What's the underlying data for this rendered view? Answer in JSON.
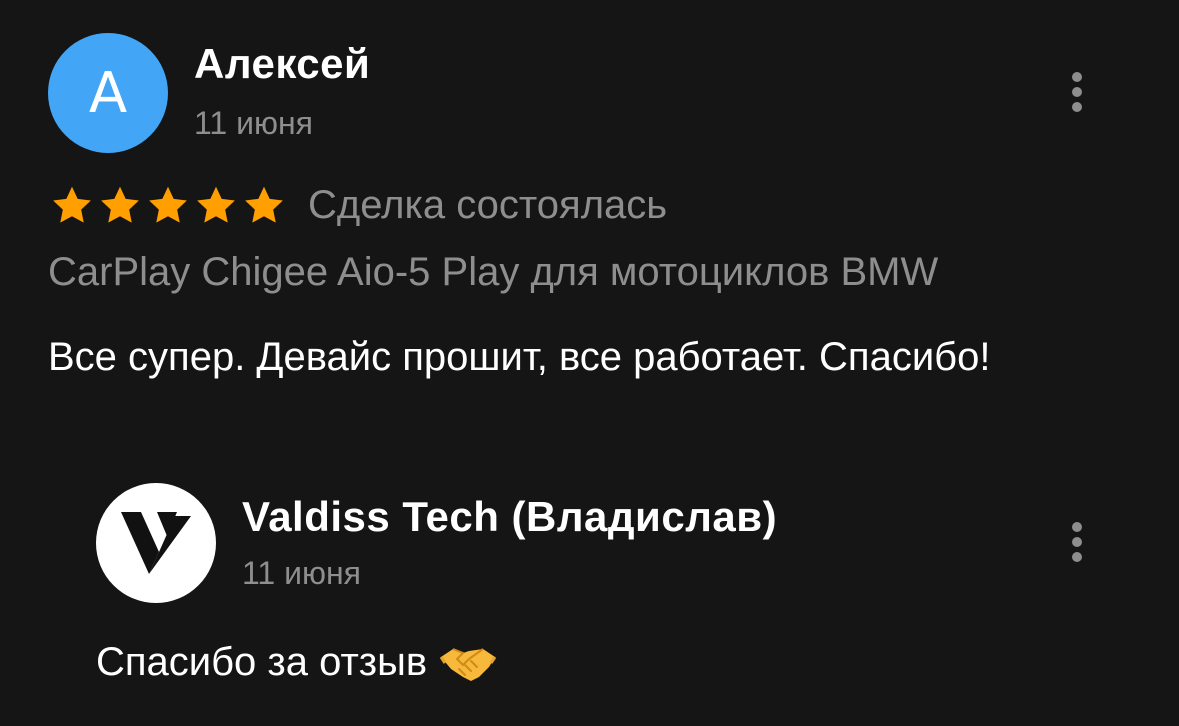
{
  "review": {
    "avatar_letter": "А",
    "author": "Алексей",
    "date": "11 июня",
    "rating": 5,
    "rating_max": 5,
    "deal_status": "Сделка состоялась",
    "product": "CarPlay Chigee Aio-5 Play для мотоциклов BMW",
    "text": "Все супер. Девайс прошит, все работает. Спасибо!",
    "menu_icon": "more-vertical-icon"
  },
  "reply": {
    "author": "Valdiss Tech (Владислав)",
    "date": "11 июня",
    "text": "Спасибо за отзыв",
    "emoji_icon": "handshake-icon",
    "menu_icon": "more-vertical-icon"
  },
  "colors": {
    "background": "#151515",
    "avatar_blue": "#42a5f5",
    "star": "#ffa000",
    "muted_text": "#8e8e8e",
    "text": "#ffffff"
  }
}
